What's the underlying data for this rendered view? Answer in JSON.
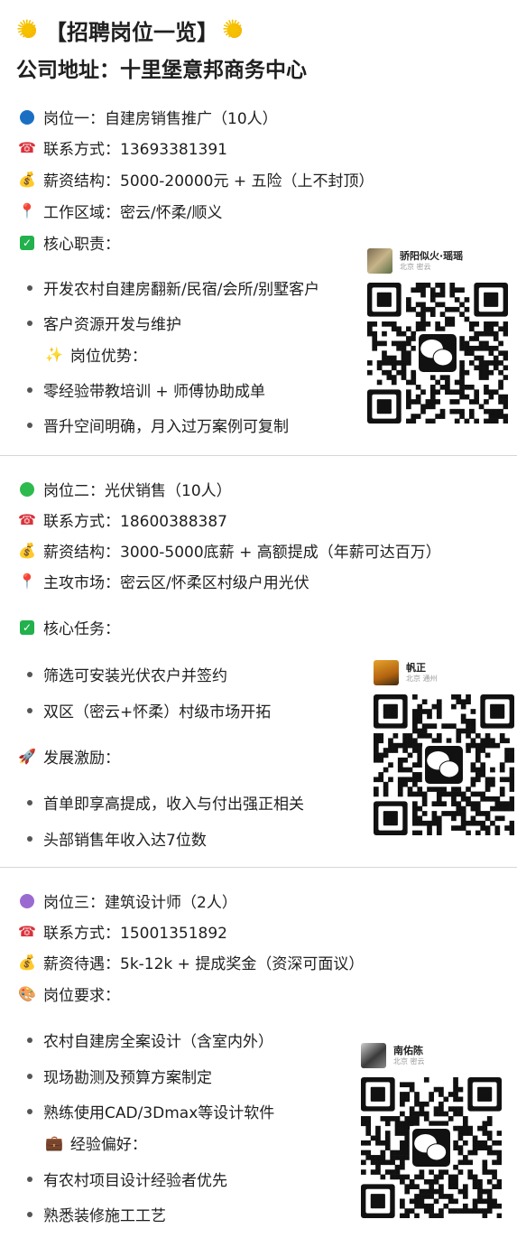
{
  "header": {
    "title": "【招聘岗位一览】",
    "address": "公司地址：十里堡意邦商务中心"
  },
  "job1": {
    "name": "岗位一：自建房销售推广（10人）",
    "contact": "联系方式：13693381391",
    "salary": "薪资结构：5000-20000元 + 五险（上不封顶）",
    "area": "工作区域：密云/怀柔/顺义",
    "duties_title": "核心职责：",
    "duties": [
      "开发农村自建房翻新/民宿/会所/别墅客户",
      "客户资源开发与维护"
    ],
    "adv_title": "岗位优势：",
    "advantages": [
      "零经验带教培训 + 师傅协助成单",
      "晋升空间明确，月入过万案例可复制"
    ],
    "qr": {
      "name": "骄阳似火·瑶瑶",
      "location": "北京 密云"
    }
  },
  "job2": {
    "name": "岗位二：光伏销售（10人）",
    "contact": "联系方式：18600388387",
    "salary": "薪资结构：3000-5000底薪 + 高额提成（年薪可达百万）",
    "market": "主攻市场：密云区/怀柔区村级户用光伏",
    "tasks_title": "核心任务：",
    "tasks": [
      "筛选可安装光伏农户并签约",
      "双区（密云+怀柔）村级市场开拓"
    ],
    "incentive_title": "发展激励：",
    "incentives": [
      "首单即享高提成，收入与付出强正相关",
      "头部销售年收入达7位数"
    ],
    "qr": {
      "name": "帆正",
      "location": "北京 通州"
    }
  },
  "job3": {
    "name": "岗位三：建筑设计师（2人）",
    "contact": "联系方式：15001351892",
    "salary": "薪资待遇：5k-12k + 提成奖金（资深可面议）",
    "req_title": "岗位要求：",
    "requirements": [
      "农村自建房全案设计（含室内外）",
      "现场勘测及预算方案制定",
      "熟练使用CAD/3Dmax等设计软件"
    ],
    "pref_title": "经验偏好：",
    "preferences": [
      "有农村项目设计经验者优先",
      "熟悉装修施工工艺"
    ],
    "qr": {
      "name": "南佑陈",
      "location": "北京 密云"
    }
  },
  "icons": {
    "job1_dot": "blue-circle-icon",
    "job2_dot": "green-circle-icon",
    "job3_dot": "purple-circle-icon",
    "phone": "telephone-icon",
    "salary": "money-bag-icon",
    "area": "pushpin-icon",
    "check": "check-box-icon",
    "sparkle": "sparkles-icon",
    "rocket": "rocket-icon",
    "palette": "palette-icon",
    "briefcase": "briefcase-icon"
  },
  "colors": {
    "blue": "#1b6fc2",
    "green": "#2dbb4e",
    "purple": "#9b6ad1",
    "check_green": "#22b14c"
  }
}
